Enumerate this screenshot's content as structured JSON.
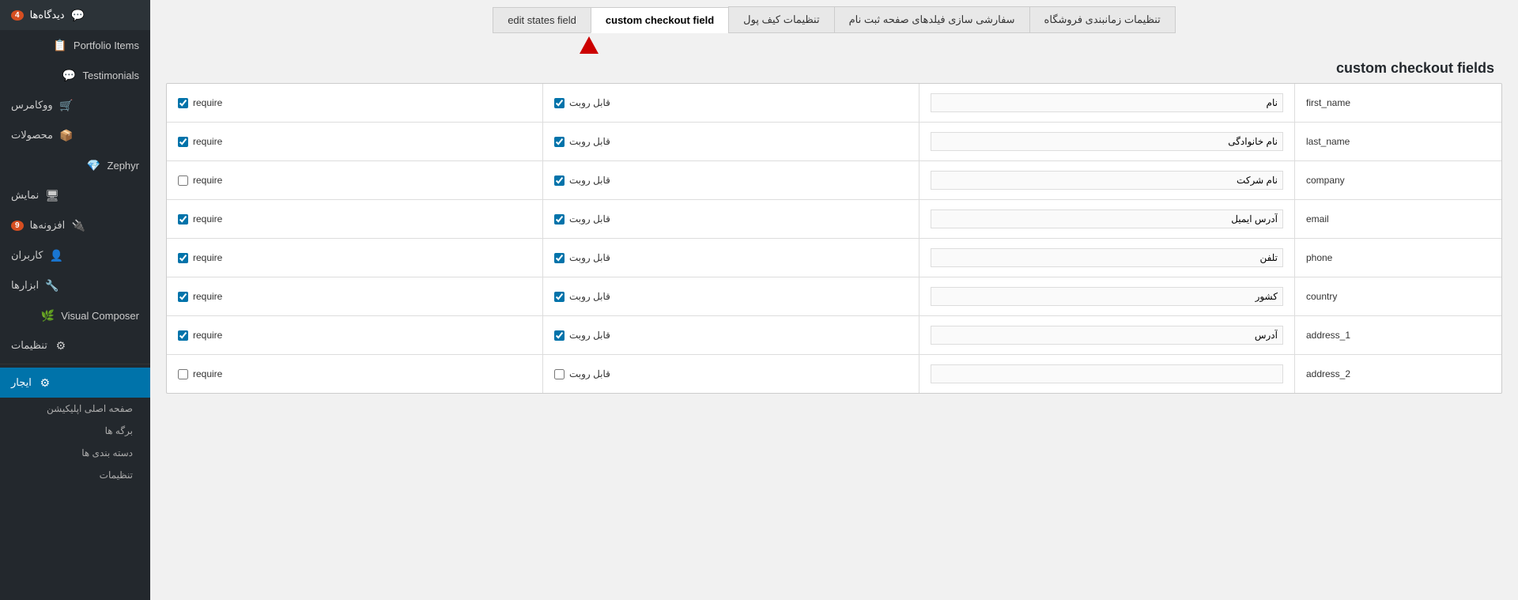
{
  "sidebar": {
    "items": [
      {
        "id": "dashboard",
        "label": "دیدگاه‌ها",
        "icon": "💬",
        "badge": "4",
        "active": false
      },
      {
        "id": "portfolio",
        "label": "Portfolio Items",
        "icon": "📋",
        "badge": null,
        "active": false
      },
      {
        "id": "testimonials",
        "label": "Testimonials",
        "icon": "💬",
        "badge": null,
        "active": false
      },
      {
        "id": "woocommerce",
        "label": "ووکامرس",
        "icon": "🛒",
        "badge": null,
        "active": false
      },
      {
        "id": "products",
        "label": "محصولات",
        "icon": "📦",
        "badge": null,
        "active": false
      },
      {
        "id": "zephyr",
        "label": "Zephyr",
        "icon": "💎",
        "badge": null,
        "active": false
      },
      {
        "id": "display",
        "label": "نمایش",
        "icon": "🖥",
        "badge": null,
        "active": false
      },
      {
        "id": "plugins",
        "label": "افزونه‌ها",
        "icon": "🔌",
        "badge": "9",
        "active": false
      },
      {
        "id": "users",
        "label": "کاربران",
        "icon": "👤",
        "badge": null,
        "active": false
      },
      {
        "id": "tools",
        "label": "ابزارها",
        "icon": "🔧",
        "badge": null,
        "active": false
      },
      {
        "id": "visual-composer",
        "label": "Visual Composer",
        "icon": "🌿",
        "badge": null,
        "active": false
      },
      {
        "id": "settings",
        "label": "تنظیمات",
        "icon": "⚙",
        "badge": null,
        "active": false
      },
      {
        "id": "ijarah",
        "label": "ایجار",
        "icon": "⚙",
        "badge": null,
        "active": true
      }
    ],
    "sub_items": [
      {
        "id": "main-page",
        "label": "صفحه اصلی اپلیکیشن"
      },
      {
        "id": "pages",
        "label": "برگه ها"
      },
      {
        "id": "categories",
        "label": "دسته بندی ها"
      },
      {
        "id": "sub-settings",
        "label": "تنظیمات"
      }
    ]
  },
  "tabs": [
    {
      "id": "edit-states",
      "label": "edit states field",
      "active": false
    },
    {
      "id": "custom-checkout",
      "label": "custom checkout field",
      "active": true
    },
    {
      "id": "wallet-settings",
      "label": "تنظیمات کیف پول",
      "active": false
    },
    {
      "id": "registration-fields",
      "label": "سفارشی سازی فیلدهای صفحه ثبت نام",
      "active": false
    },
    {
      "id": "store-settings",
      "label": "تنظیمات زمانبندی فروشگاه",
      "active": false
    }
  ],
  "page_heading": "custom checkout fields",
  "table": {
    "rows": [
      {
        "field_name": "first_name",
        "label_placeholder": "نام",
        "visible_checked": true,
        "visible_label": "قابل روبت",
        "require_checked": true,
        "require_label": "require"
      },
      {
        "field_name": "last_name",
        "label_placeholder": "نام خانوادگی",
        "visible_checked": true,
        "visible_label": "قابل روبت",
        "require_checked": true,
        "require_label": "require"
      },
      {
        "field_name": "company",
        "label_placeholder": "نام شرکت",
        "visible_checked": true,
        "visible_label": "قابل روبت",
        "require_checked": false,
        "require_label": "require"
      },
      {
        "field_name": "email",
        "label_placeholder": "آدرس ایمیل",
        "visible_checked": true,
        "visible_label": "قابل روبت",
        "require_checked": true,
        "require_label": "require"
      },
      {
        "field_name": "phone",
        "label_placeholder": "تلفن",
        "visible_checked": true,
        "visible_label": "قابل روبت",
        "require_checked": true,
        "require_label": "require"
      },
      {
        "field_name": "country",
        "label_placeholder": "کشور",
        "visible_checked": true,
        "visible_label": "قابل روبت",
        "require_checked": true,
        "require_label": "require"
      },
      {
        "field_name": "address_1",
        "label_placeholder": "آدرس",
        "visible_checked": true,
        "visible_label": "قابل روبت",
        "require_checked": true,
        "require_label": "require"
      },
      {
        "field_name": "address_2",
        "label_placeholder": "",
        "visible_checked": false,
        "visible_label": "قابل روبت",
        "require_checked": false,
        "require_label": "require"
      }
    ]
  }
}
